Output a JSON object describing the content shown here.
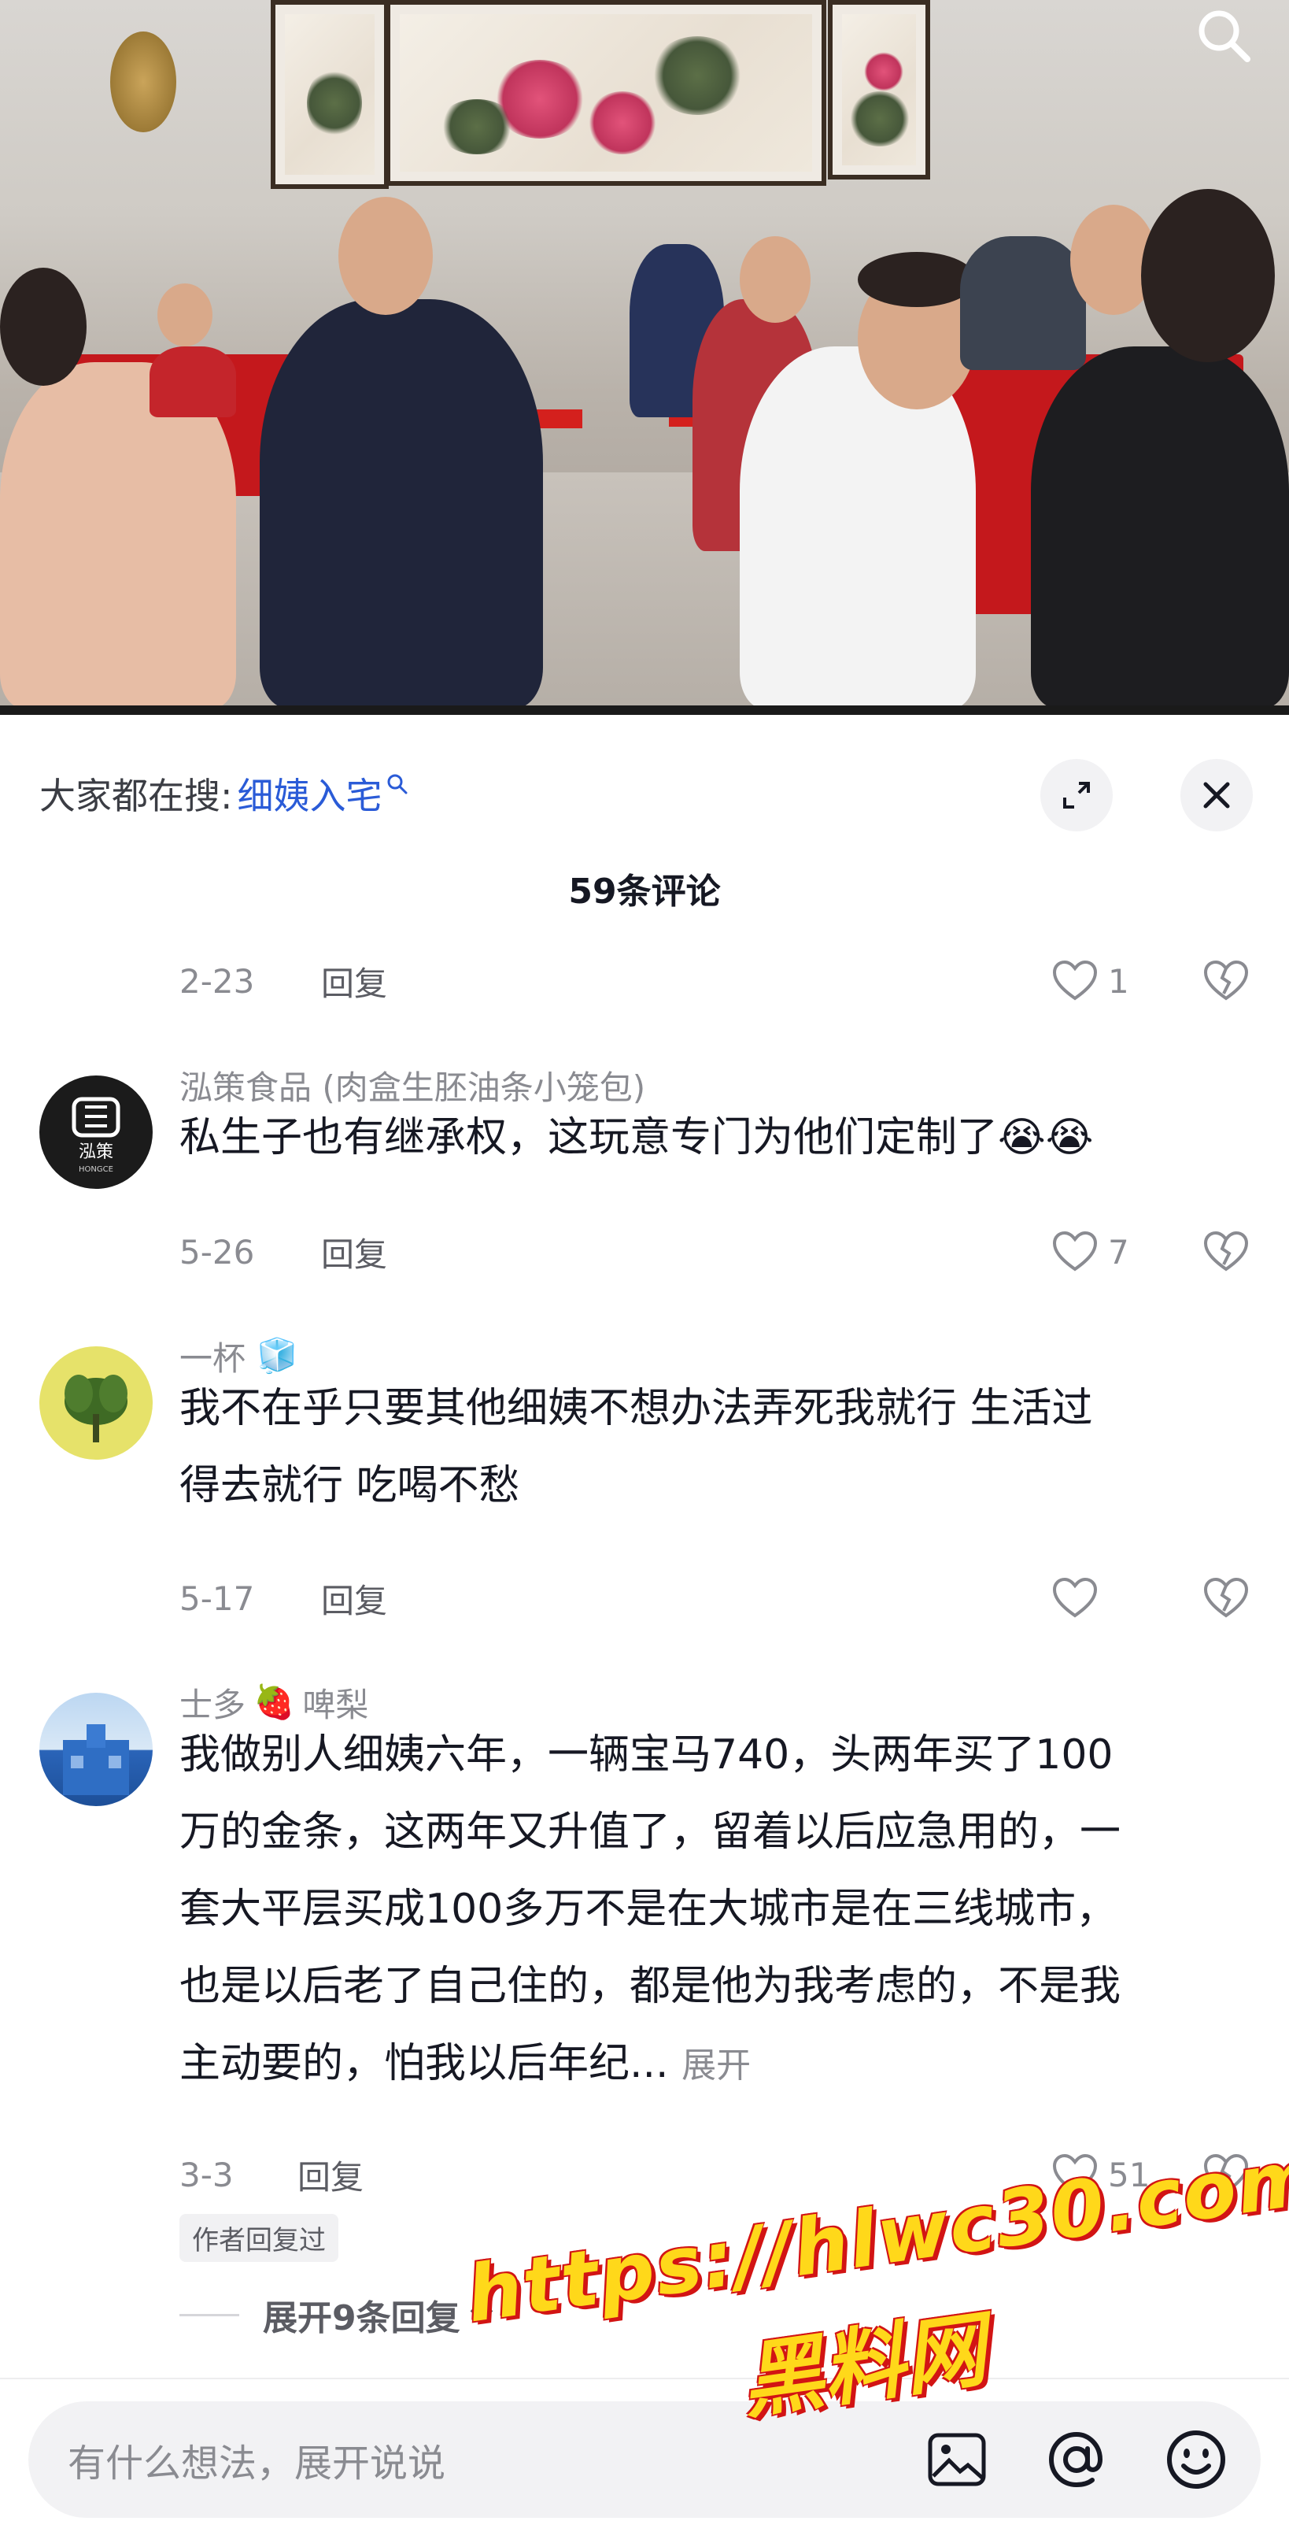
{
  "hot_search": {
    "prefix": "大家都在搜:",
    "term": "细姨入宅"
  },
  "comments_header": {
    "count_label": "59条评论"
  },
  "previous_comment": {
    "date": "2-23",
    "reply_label": "回复",
    "likes": "1"
  },
  "comments": [
    {
      "username": "泓策食品 (肉盒生胚油条小笼包)",
      "text": "私生子也有继承权，这玩意专门为他们定制了",
      "emojis": [
        "😭",
        "😭"
      ],
      "date": "5-26",
      "reply_label": "回复",
      "likes": "7"
    },
    {
      "username": "一杯",
      "username_emoji": "🧊",
      "text_lines": [
        "我不在乎只要其他细姨不想办法弄死我就行  生活过",
        "得去就行  吃喝不愁"
      ],
      "date": "5-17",
      "reply_label": "回复",
      "likes": ""
    },
    {
      "username_a": "士多",
      "username_emoji": "🍓",
      "username_b": "啤梨",
      "text_lines": [
        "我做别人细姨六年，一辆宝马740，头两年买了100",
        "万的金条，这两年又升值了，留着以后应急用的，一",
        "套大平层买成100多万不是在大城市是在三线城市，",
        "也是以后老了自己住的，都是他为我考虑的，不是我",
        "主动要的，怕我以后年纪..."
      ],
      "expand_inline": "展开",
      "date": "3-3",
      "reply_label": "回复",
      "likes": "51",
      "author_badge": "作者回复过",
      "expand_replies": "展开9条回复"
    }
  ],
  "input_bar": {
    "placeholder": "有什么想法，展开说说"
  },
  "avatar_logo": {
    "text": "泓策",
    "subtext": "HONGCE"
  },
  "watermark": {
    "line1": "https://hlwc30.com",
    "line2": "黑料网"
  },
  "colors": {
    "link_blue": "#2a5bd7",
    "muted_gray": "#8a8b91",
    "text_dark": "#161823",
    "table_red": "#c4181c",
    "watermark_yellow": "#ffd81a",
    "watermark_red": "#d21414"
  }
}
